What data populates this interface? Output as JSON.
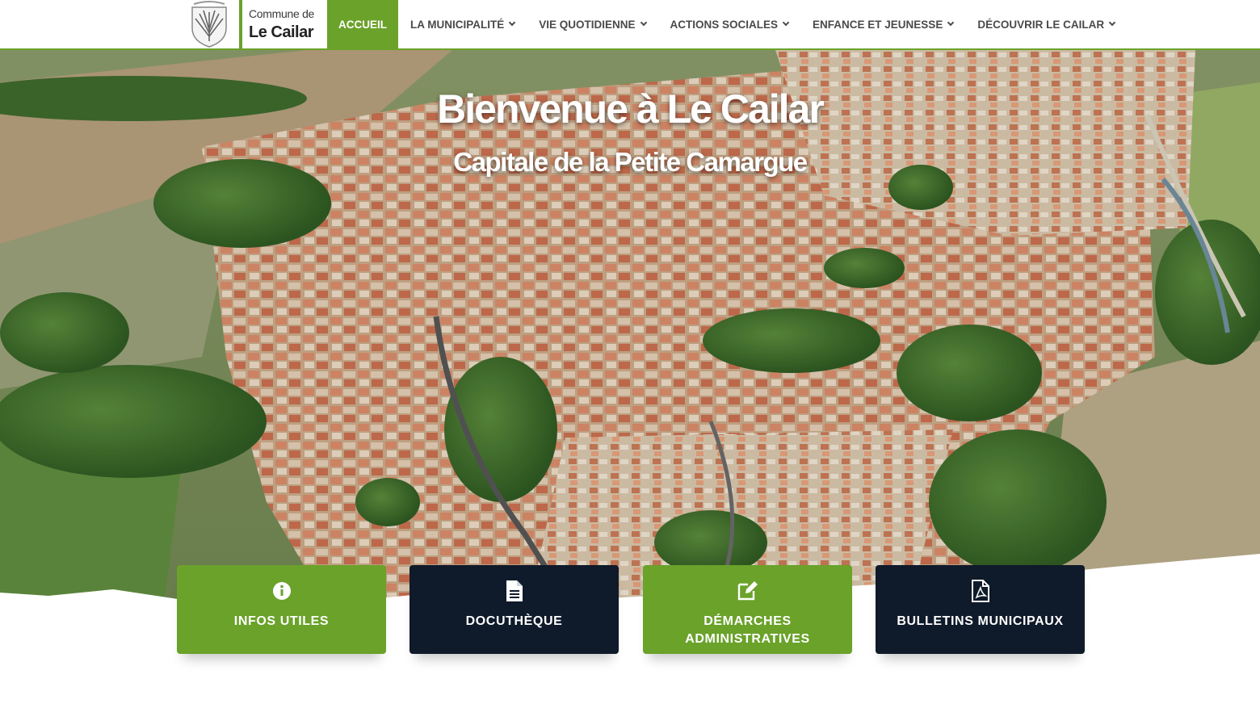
{
  "site": {
    "logo_small": "Commune de",
    "logo_big": "Le Cailar"
  },
  "nav": {
    "items": [
      {
        "label": "ACCUEIL",
        "active": true,
        "has_dropdown": false
      },
      {
        "label": "LA MUNICIPALITÉ",
        "active": false,
        "has_dropdown": true
      },
      {
        "label": "VIE QUOTIDIENNE",
        "active": false,
        "has_dropdown": true
      },
      {
        "label": "ACTIONS SOCIALES",
        "active": false,
        "has_dropdown": true
      },
      {
        "label": "ENFANCE ET JEUNESSE",
        "active": false,
        "has_dropdown": true
      },
      {
        "label": "DÉCOUVRIR LE CAILAR",
        "active": false,
        "has_dropdown": true
      }
    ]
  },
  "hero": {
    "title": "Bienvenue à Le Cailar",
    "subtitle": "Capitale de la Petite Camargue"
  },
  "cards": [
    {
      "label": "INFOS UTILES",
      "icon": "info-circle-icon",
      "color": "#6aa22a"
    },
    {
      "label": "DOCUTHÈQUE",
      "icon": "document-icon",
      "color": "#0f1a2a"
    },
    {
      "label": "DÉMARCHES ADMINISTRATIVES",
      "icon": "edit-icon",
      "color": "#6aa22a"
    },
    {
      "label": "BULLETINS MUNICIPAUX",
      "icon": "pdf-file-icon",
      "color": "#0f1a2a"
    }
  ],
  "colors": {
    "accent_green": "#6aa22a",
    "dark_navy": "#0f1a2a"
  }
}
